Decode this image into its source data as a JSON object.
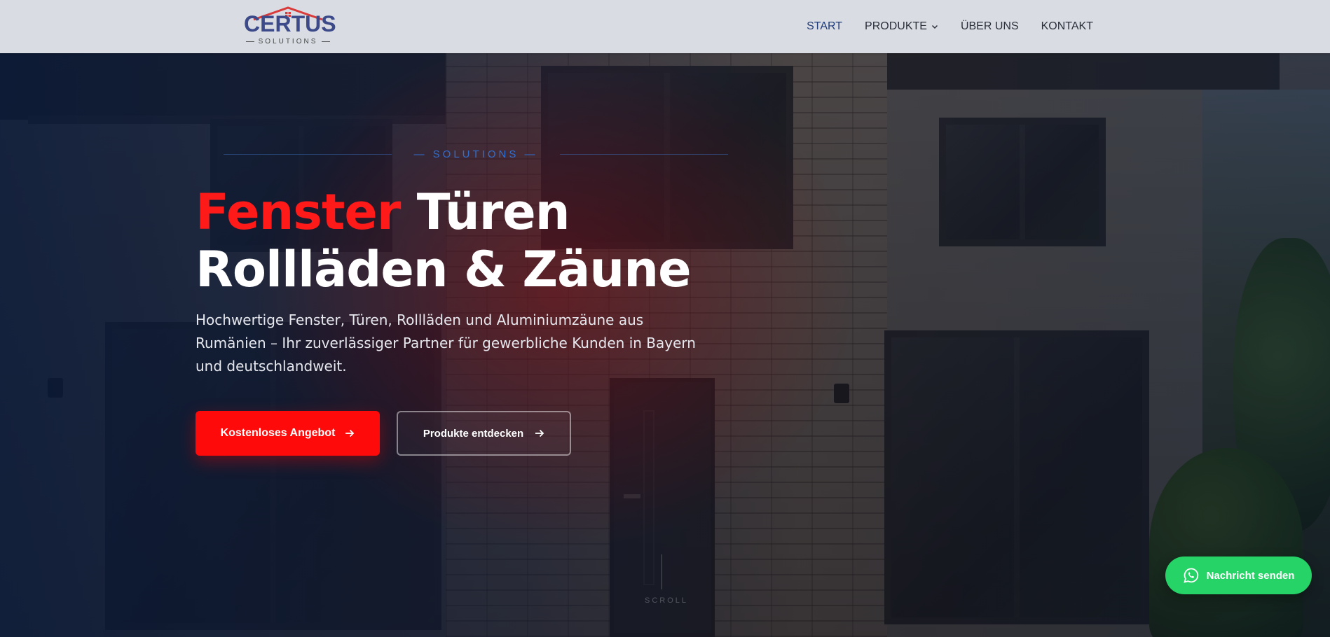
{
  "header": {
    "logo": {
      "name": "CERTUS",
      "subtitle": "SOLUTIONS"
    },
    "nav": [
      {
        "label": "START",
        "active": true
      },
      {
        "label": "PRODUKTE",
        "has_dropdown": true
      },
      {
        "label": "ÜBER UNS"
      },
      {
        "label": "KONTAKT"
      }
    ]
  },
  "hero": {
    "eyebrow": "SOLUTIONS",
    "title_accent": "Fenster",
    "title_line1_rest": "Türen",
    "title_line2": "Rollläden & Zäune",
    "lead": "Hochwertige Fenster, Türen, Rollläden und Aluminiumzäune aus Rumänien – Ihr zuverlässiger Partner für gewerbliche Kunden in Bayern und deutschlandweit.",
    "primary_button": "Kostenloses Angebot",
    "secondary_button": "Produkte entdecken",
    "scroll_label": "SCROLL"
  },
  "whatsapp": {
    "label": "Nachricht senden",
    "icon": "whatsapp-icon"
  },
  "colors": {
    "accent_red": "#ff0a0a",
    "nav_active": "#1f3a78",
    "logo_blue": "#3c4a8a",
    "whatsapp_green": "#25d366"
  }
}
